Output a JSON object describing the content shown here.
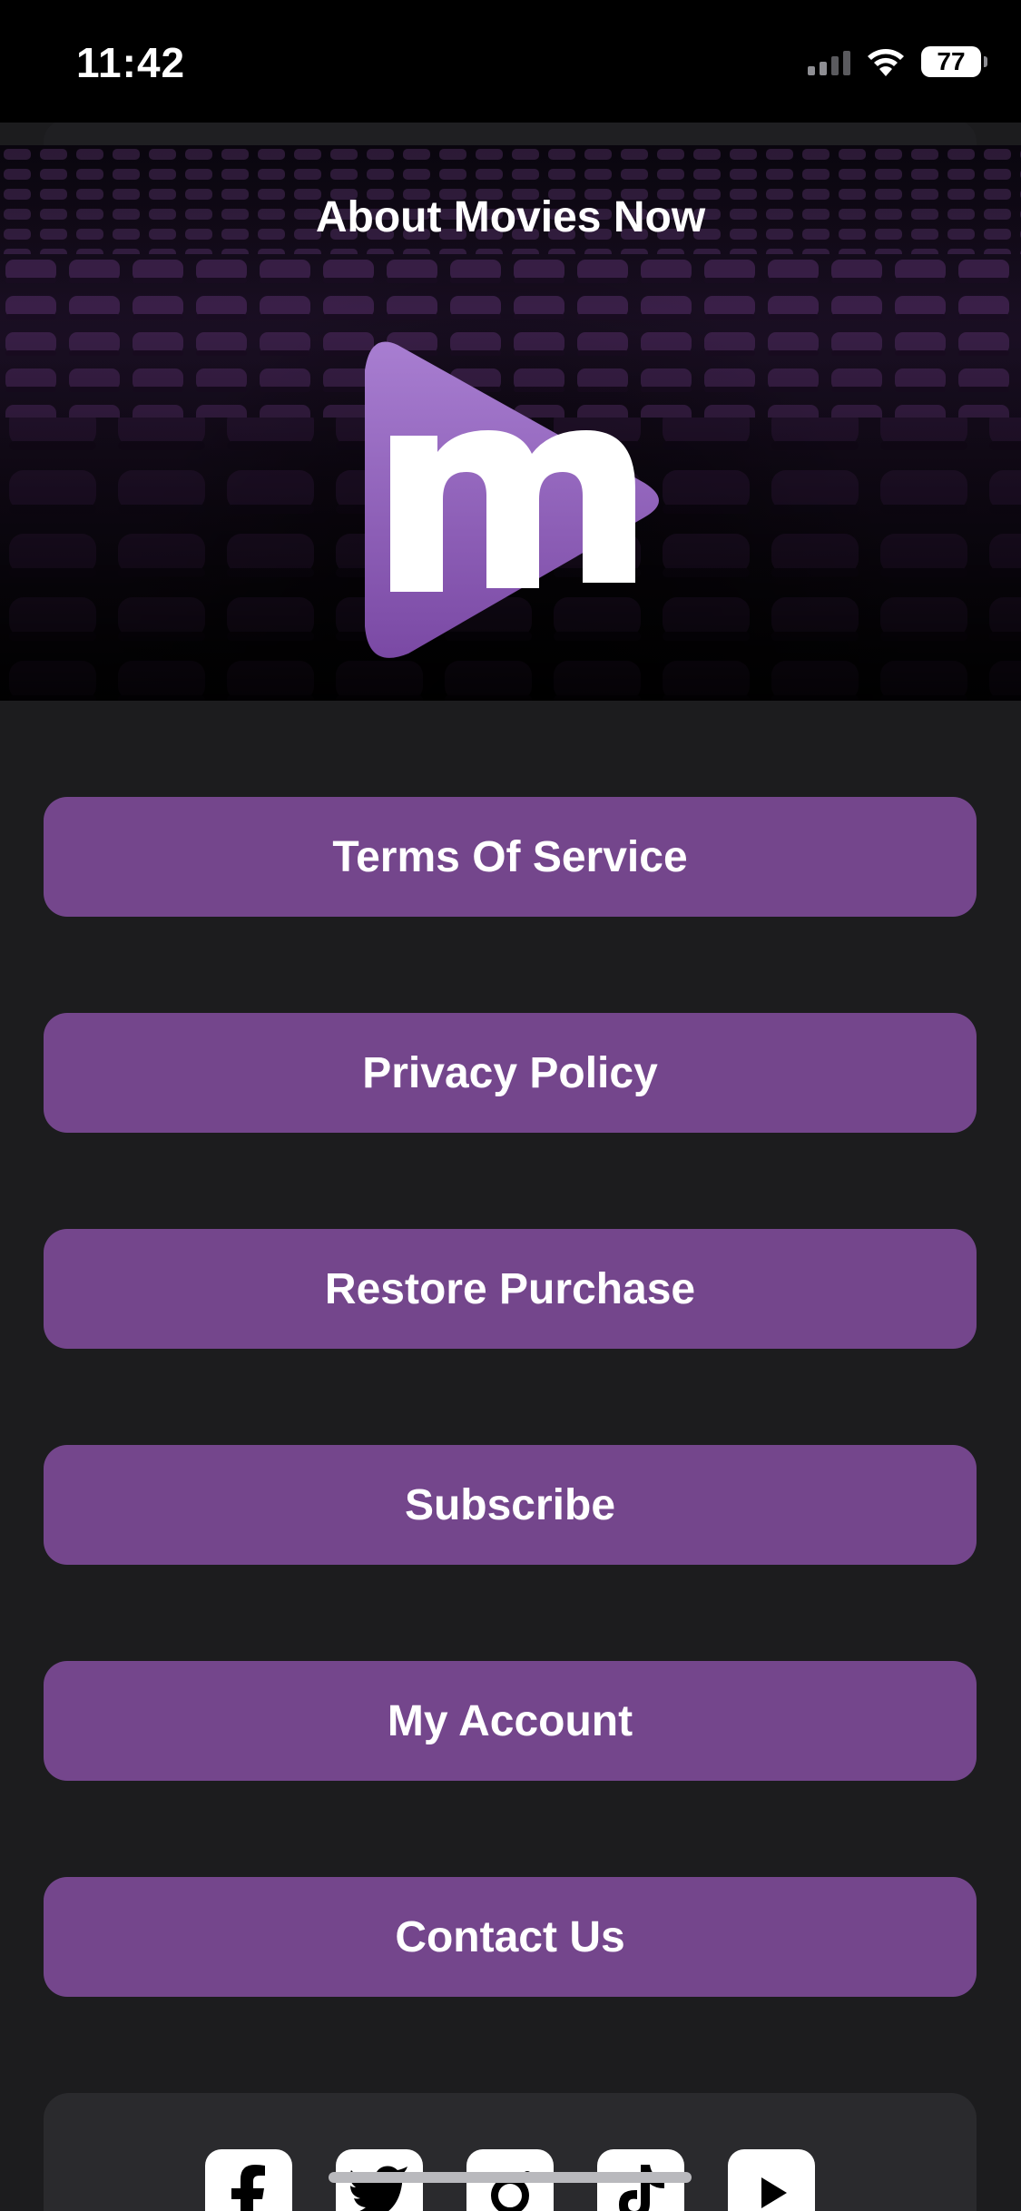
{
  "status_bar": {
    "time": "11:42",
    "battery": "77",
    "icons": [
      "signal-icon",
      "wifi-icon",
      "battery-icon"
    ]
  },
  "hero": {
    "title": "About Movies Now",
    "logo_letter": "m",
    "logo_color": "#8d5cb4"
  },
  "menu": {
    "buttons": [
      "Terms Of Service",
      "Privacy Policy",
      "Restore Purchase",
      "Subscribe",
      "My Account",
      "Contact Us"
    ],
    "button_color": "#74468c"
  },
  "social": {
    "icons": [
      "facebook-icon",
      "twitter-icon",
      "instagram-icon",
      "tiktok-icon",
      "youtube-icon"
    ]
  }
}
